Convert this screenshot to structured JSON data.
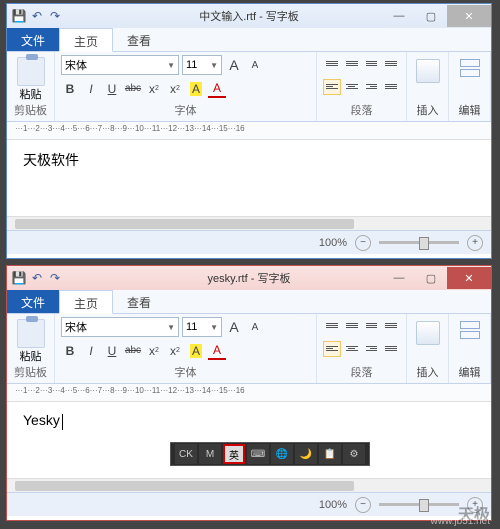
{
  "windows": [
    {
      "qat": [
        "💾",
        "↶",
        "↷"
      ],
      "title": "中文输入.rtf - 写字板",
      "tabs": {
        "file": "文件",
        "home": "主页",
        "view": "查看"
      },
      "ribbon": {
        "clipboard": "粘贴",
        "clipboard_group": "剪贴板",
        "font_name": "宋体",
        "font_size": "11",
        "grow": "A",
        "shrink": "A",
        "bold": "B",
        "italic": "I",
        "underline": "U",
        "strike": "abc",
        "sub": "x",
        "sup": "x",
        "color": "A",
        "highlight": "A",
        "font_group": "字体",
        "para_group": "段落",
        "insert": "插入",
        "edit": "编辑"
      },
      "ruler": "···1···2···3···4···5···6···7···8···9···10···11···12···13···14···15···16",
      "content": "天极软件",
      "zoom": "100%"
    },
    {
      "qat": [
        "💾",
        "↶",
        "↷"
      ],
      "title": "yesky.rtf - 写字板",
      "tabs": {
        "file": "文件",
        "home": "主页",
        "view": "查看"
      },
      "ribbon": {
        "clipboard": "粘贴",
        "clipboard_group": "剪贴板",
        "font_name": "宋体",
        "font_size": "11",
        "grow": "A",
        "shrink": "A",
        "bold": "B",
        "italic": "I",
        "underline": "U",
        "strike": "abc",
        "sub": "x",
        "sup": "x",
        "color": "A",
        "highlight": "A",
        "font_group": "字体",
        "para_group": "段落",
        "insert": "插入",
        "edit": "编辑"
      },
      "ruler": "···1···2···3···4···5···6···7···8···9···10···11···12···13···14···15···16",
      "content": "Yesky",
      "zoom": "100%"
    }
  ],
  "ime": {
    "items": [
      "CK",
      "M",
      "英",
      "⌨",
      "🌐",
      "🌙",
      "📋",
      "⚙"
    ],
    "highlighted": 2
  },
  "watermark": "天极",
  "watermark2": "www.jb51.net"
}
